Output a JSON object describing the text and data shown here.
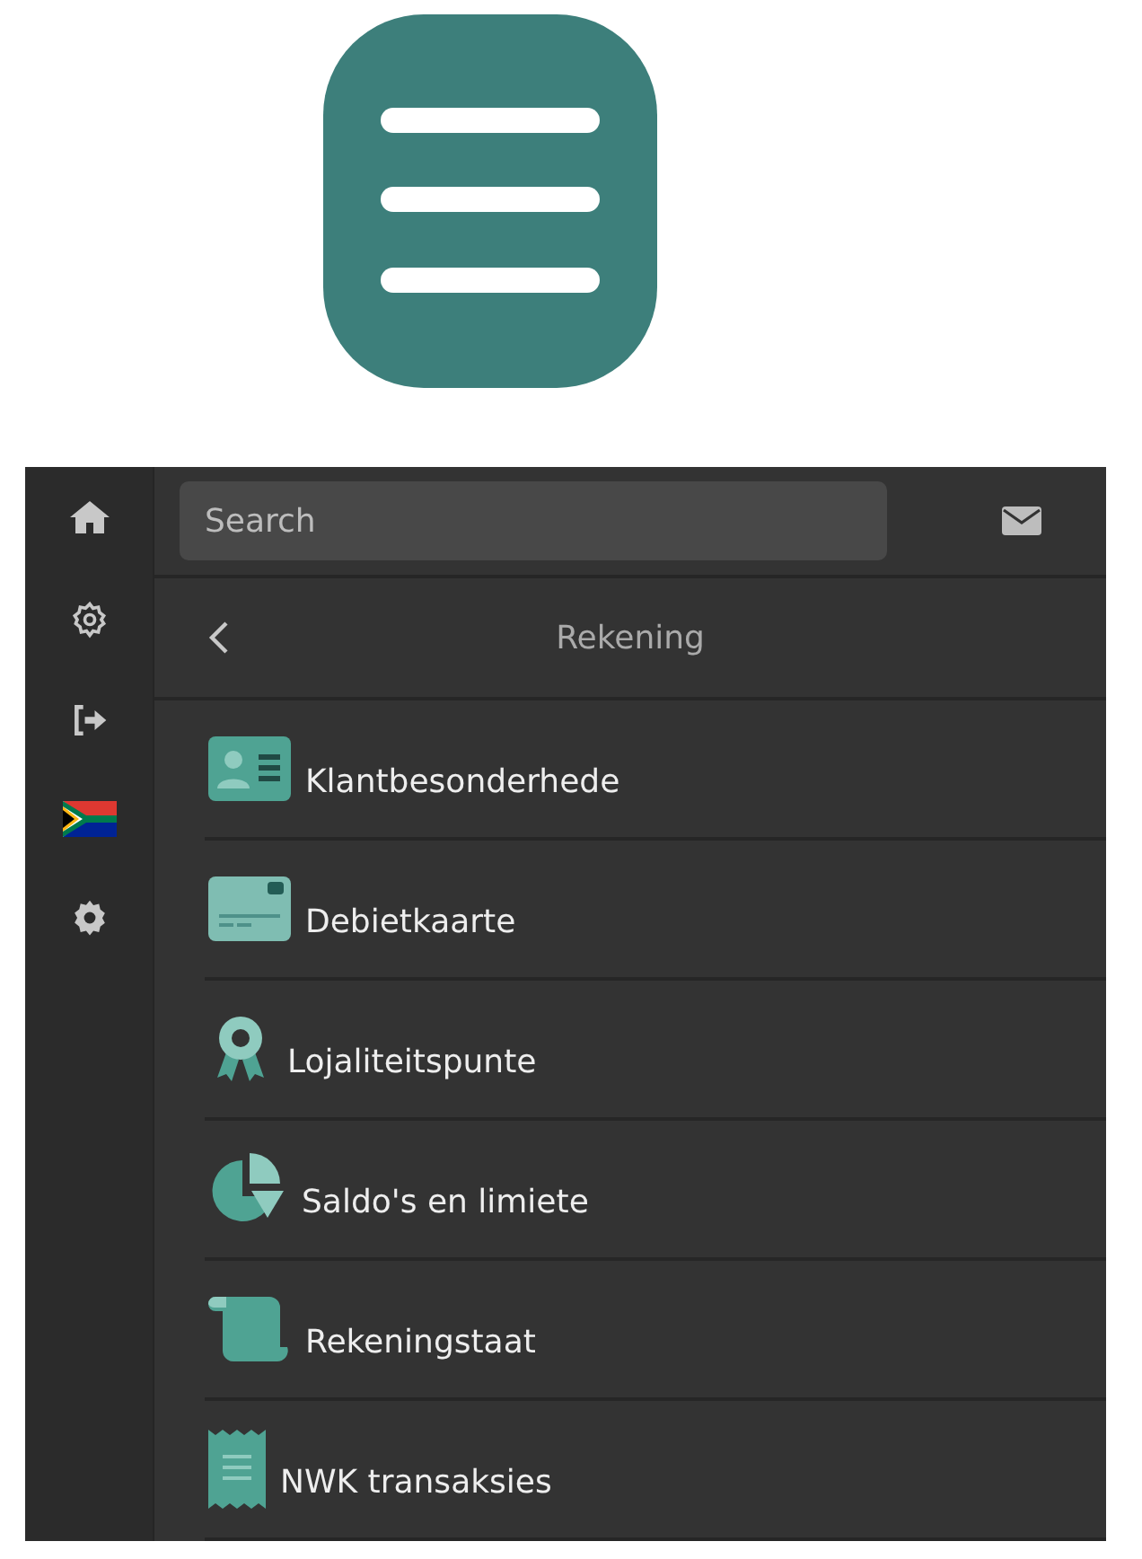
{
  "search": {
    "placeholder": "Search"
  },
  "page_title": "Rekening",
  "items": [
    {
      "label": "Klantbesonderhede"
    },
    {
      "label": "Debietkaarte"
    },
    {
      "label": "Lojaliteitspunte"
    },
    {
      "label": "Saldo's en limiete"
    },
    {
      "label": "Rekeningstaat"
    },
    {
      "label": "NWK transaksies"
    }
  ]
}
